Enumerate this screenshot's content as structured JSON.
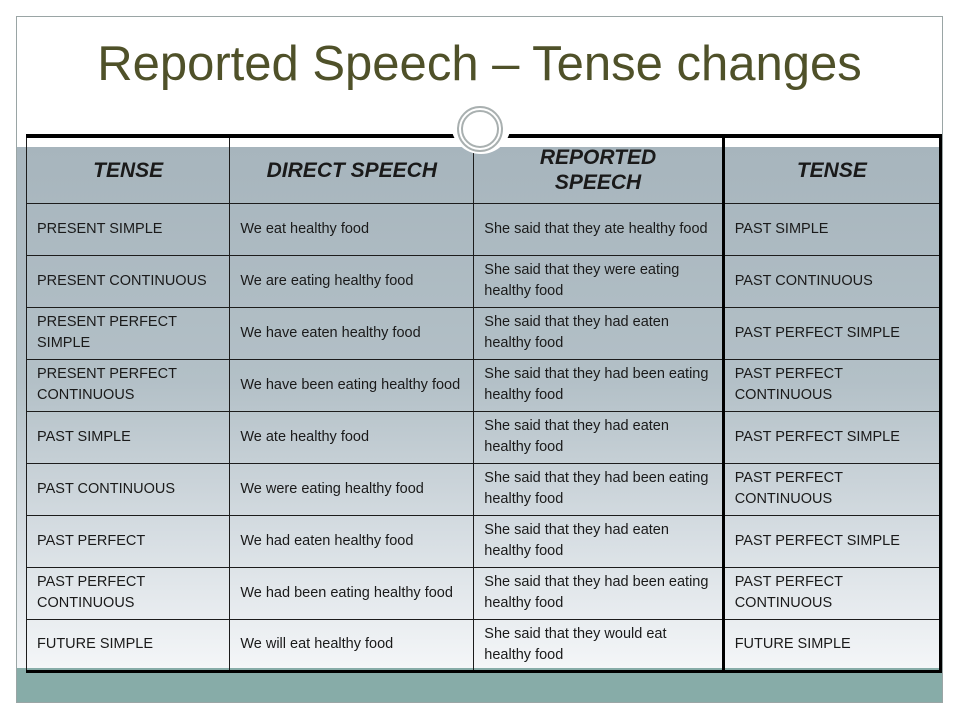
{
  "slide": {
    "title": "Reported Speech – Tense changes",
    "colors": {
      "title_text": "#4f5129",
      "band_top": "#a7b5bd",
      "band_bottom": "#f4f6f8",
      "footer_band": "#87aca8",
      "border": "#1c1c1c"
    },
    "decoration_icon": "double-ring-icon"
  },
  "table": {
    "headers": [
      "TENSE",
      "DIRECT SPEECH",
      "REPORTED SPEECH",
      "TENSE"
    ],
    "rows": [
      [
        "PRESENT SIMPLE",
        "We eat healthy food",
        "She said that they ate healthy food",
        "PAST SIMPLE"
      ],
      [
        "PRESENT CONTINUOUS",
        "We are eating healthy food",
        "She said that they were eating healthy food",
        "PAST CONTINUOUS"
      ],
      [
        "PRESENT PERFECT SIMPLE",
        "We have eaten healthy food",
        "She said that they had eaten healthy food",
        "PAST PERFECT SIMPLE"
      ],
      [
        "PRESENT PERFECT CONTINUOUS",
        "We have been eating healthy food",
        "She said that they had been eating healthy food",
        "PAST PERFECT CONTINUOUS"
      ],
      [
        "PAST SIMPLE",
        "We ate healthy food",
        "She said that they had eaten healthy food",
        "PAST PERFECT SIMPLE"
      ],
      [
        "PAST CONTINUOUS",
        "We were eating healthy food",
        "She said that they had been eating healthy food",
        "PAST PERFECT CONTINUOUS"
      ],
      [
        "PAST PERFECT",
        "We had eaten healthy food",
        "She said that they had eaten healthy food",
        "PAST PERFECT SIMPLE"
      ],
      [
        "PAST PERFECT CONTINUOUS",
        "We had been eating healthy food",
        "She said that they had been eating healthy food",
        "PAST PERFECT CONTINUOUS"
      ],
      [
        "FUTURE SIMPLE",
        "We will eat healthy food",
        "She said that they would eat healthy food",
        "FUTURE SIMPLE"
      ]
    ]
  }
}
